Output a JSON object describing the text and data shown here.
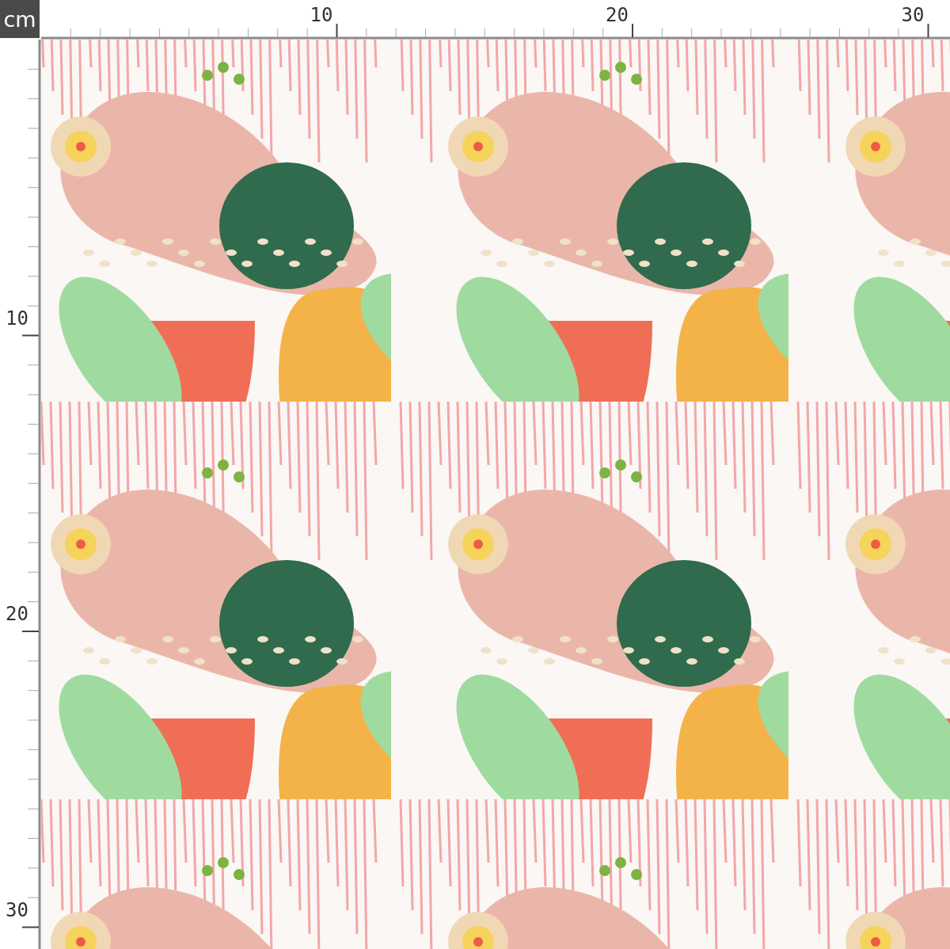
{
  "unit_label": "cm",
  "top_ruler": {
    "labels": [
      "10",
      "20",
      "30"
    ]
  },
  "left_ruler": {
    "labels": [
      "10",
      "20",
      "30"
    ]
  }
}
